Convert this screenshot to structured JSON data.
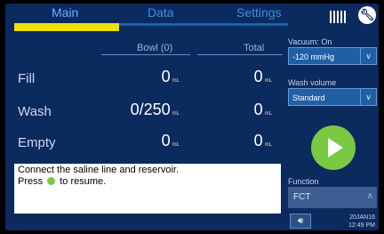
{
  "tabs": {
    "main": "Main",
    "data": "Data",
    "settings": "Settings"
  },
  "table": {
    "head_bowl": "Bowl (0)",
    "head_total": "Total",
    "rows": [
      {
        "label": "Fill",
        "bowl": "0",
        "bowl_unit": "mL",
        "total": "0",
        "total_unit": "mL"
      },
      {
        "label": "Wash",
        "bowl": "0/250",
        "bowl_unit": "mL",
        "total": "0",
        "total_unit": "mL"
      },
      {
        "label": "Empty",
        "bowl": "0",
        "bowl_unit": "mL",
        "total": "0",
        "total_unit": "mL"
      }
    ]
  },
  "message": {
    "line1": "Connect the saline line and reservoir.",
    "line2_pre": "Press",
    "line2_post": "to resume."
  },
  "right_panel": {
    "vacuum_label": "Vacuum: On",
    "vacuum_value": "-120 mmHg",
    "wash_volume_label": "Wash volume",
    "wash_volume_value": "Standard",
    "function_label": "Function",
    "function_value": "FCT"
  },
  "status": {
    "date": "20JAN16",
    "time": "12:49 PM"
  },
  "icons": {
    "barcode": "barcode-icon",
    "wrench": "wrench-icon",
    "play": "play-icon",
    "speaker": "speaker-icon"
  },
  "colors": {
    "background": "#0b2a5e",
    "active_tab_marker": "#f2e000",
    "play_button": "#7ac943",
    "dropdown": "#1f5fa6"
  }
}
